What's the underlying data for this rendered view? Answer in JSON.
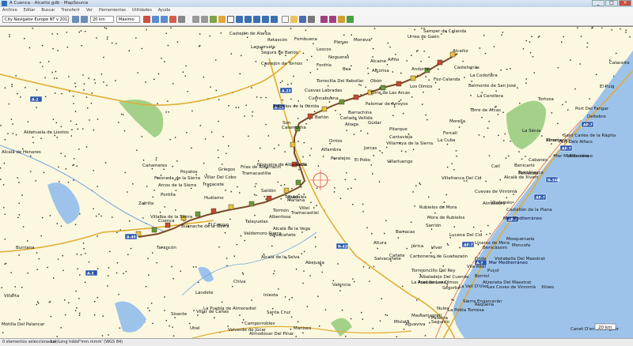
{
  "window": {
    "title": "A Cuenca - Alcañiz.gdb - MapSource"
  },
  "menu": [
    "Archivo",
    "Editar",
    "Buscar",
    "Transferir",
    "Ver",
    "Herramientas",
    "Utilidades",
    "Ayuda"
  ],
  "toolbar": {
    "map_product": "City Navigator Europe NT v 2013.1",
    "zoom": "20 km",
    "detail": "Máximo"
  },
  "status": {
    "selected": "0 elementos seleccionados",
    "coords": "Lat/Long hddd°mm.mmm' (WGS 84)"
  },
  "scale": "20 km",
  "cities": [
    {
      "name": "Castejón de Alarba"
    },
    {
      "name": "Retascón"
    },
    {
      "name": "Fombuena"
    },
    {
      "name": "Plenas"
    },
    {
      "name": "Moneva"
    },
    {
      "name": "Samper de Calanda"
    },
    {
      "name": "Urrea de Gaén"
    },
    {
      "name": "Alcañiz"
    },
    {
      "name": "Lagueruela"
    },
    {
      "name": "Loscos"
    },
    {
      "name": "Nogueras"
    },
    {
      "name": "Segura de Baños"
    },
    {
      "name": "Alcaine"
    },
    {
      "name": "Ariño"
    },
    {
      "name": "Andorra"
    },
    {
      "name": "Calaceite"
    },
    {
      "name": "Castelserás"
    },
    {
      "name": "Castejón de Tornos"
    },
    {
      "name": "Fonfría"
    },
    {
      "name": "Bea"
    },
    {
      "name": "Alcorisa"
    },
    {
      "name": "Foz-Calanda"
    },
    {
      "name": "La Codoñera"
    },
    {
      "name": "Torrecilla Del Rebollar"
    },
    {
      "name": "Obón"
    },
    {
      "name": "Los Olmos"
    },
    {
      "name": "Belmonte de San José"
    },
    {
      "name": "Cuevas Labradas"
    },
    {
      "name": "Torre de Las Arcas"
    },
    {
      "name": "La Cerollera"
    },
    {
      "name": "Rubielos de la Cérida"
    },
    {
      "name": "Cuencabuena"
    },
    {
      "name": "Palomar de Arroyos"
    },
    {
      "name": "Torre de Arcas"
    },
    {
      "name": "Tortosa"
    },
    {
      "name": "Port Del Fangar"
    },
    {
      "name": "Deltebre"
    },
    {
      "name": "Calamocha"
    },
    {
      "name": "Aliaga"
    },
    {
      "name": "Cañada Vellida"
    },
    {
      "name": "Barrachina"
    },
    {
      "name": "Son"
    },
    {
      "name": "Bañón"
    },
    {
      "name": "Gúdar"
    },
    {
      "name": "Pitarque"
    },
    {
      "name": "Morella"
    },
    {
      "name": "La Sénia"
    },
    {
      "name": "Sant Carles de la Rápita"
    },
    {
      "name": "Port Dels Alfacs"
    },
    {
      "name": "Aldehuela de Liestos"
    },
    {
      "name": "Alcalá de Henares"
    },
    {
      "name": "Orrios"
    },
    {
      "name": "Cantavieja"
    },
    {
      "name": "Forcall"
    },
    {
      "name": "La Cuba"
    },
    {
      "name": "Alfambra"
    },
    {
      "name": "Jorcas"
    },
    {
      "name": "Villarroya de la Sierra"
    },
    {
      "name": "Vinaròs"
    },
    {
      "name": "Peralejos"
    },
    {
      "name": "El Pobo"
    },
    {
      "name": "Mar Mediterráneo"
    },
    {
      "name": "Benicarló"
    },
    {
      "name": "Ulldecona"
    },
    {
      "name": "Nogueira de Albarracín"
    },
    {
      "name": "Cella"
    },
    {
      "name": "Teruel"
    },
    {
      "name": "Villarluengo"
    },
    {
      "name": "Catí"
    },
    {
      "name": "Peñíscola"
    },
    {
      "name": "Cañamares"
    },
    {
      "name": "Poyatos"
    },
    {
      "name": "Griegos"
    },
    {
      "name": "Frías de Albarracín"
    },
    {
      "name": "Fresneda de la Sierra"
    },
    {
      "name": "Villar Del Cobo"
    },
    {
      "name": "Tramacastilla"
    },
    {
      "name": "Villafranca Del Cid"
    },
    {
      "name": "Alcalà de Xivert"
    },
    {
      "name": "Torreblanca"
    },
    {
      "name": "Cabanes"
    },
    {
      "name": "Arcos de la Sierra"
    },
    {
      "name": "Tragacete"
    },
    {
      "name": "Saldón"
    },
    {
      "name": "Rubiales"
    },
    {
      "name": "Villel"
    },
    {
      "name": "Cuevas de Vinromà"
    },
    {
      "name": "Vilafamés"
    },
    {
      "name": "Castellón de la Plana"
    },
    {
      "name": "Portilla"
    },
    {
      "name": "Huélamo"
    },
    {
      "name": "Zafrilla"
    },
    {
      "name": "Tormón"
    },
    {
      "name": "El Cuervo"
    },
    {
      "name": "Albentosa"
    },
    {
      "name": "Tramacastiel"
    },
    {
      "name": "Cuenca"
    },
    {
      "name": "Buenache de la Sierra"
    },
    {
      "name": "Valdemoro-Sierra"
    },
    {
      "name": "Salvacañete"
    },
    {
      "name": "Alcalá de la Vega"
    },
    {
      "name": "Talayuelas"
    },
    {
      "name": "Lucena Del Cid"
    },
    {
      "name": "Onda"
    },
    {
      "name": "Vila-Real"
    },
    {
      "name": "Benicàssim"
    },
    {
      "name": "Burriana"
    },
    {
      "name": "Tarancón"
    },
    {
      "name": "Villalba de la Sierra"
    },
    {
      "name": "Mariana"
    },
    {
      "name": "Alcalá de la Selva"
    },
    {
      "name": "Abejuela"
    },
    {
      "name": "Aras de Los Olmos"
    },
    {
      "name": "Segorbe"
    },
    {
      "name": "La Vall D'Uixó"
    },
    {
      "name": "Nules"
    },
    {
      "name": "Sagunto"
    },
    {
      "name": "Puçol"
    },
    {
      "name": "Almenara"
    },
    {
      "name": "Aguaviva"
    },
    {
      "name": "Mislata"
    },
    {
      "name": "Massamagrell"
    },
    {
      "name": "Paterna"
    },
    {
      "name": "Manises"
    },
    {
      "name": "Utiel"
    },
    {
      "name": "Motilla Del Palancar"
    },
    {
      "name": "La Pueblanueva"
    },
    {
      "name": "Valencia"
    },
    {
      "name": "Requena"
    },
    {
      "name": "Chiva"
    },
    {
      "name": "Landete"
    },
    {
      "name": "Villarta"
    },
    {
      "name": "La Puebla de Almoradiel"
    },
    {
      "name": "Santa Cruz"
    },
    {
      "name": "Iniesta"
    },
    {
      "name": "Camporrobles"
    },
    {
      "name": "Valverde de Júcar"
    },
    {
      "name": "Almodóvar Del Pinar"
    },
    {
      "name": "Sisante"
    },
    {
      "name": "Villar de Cañas"
    },
    {
      "name": "Torrejoncillo Del Rey"
    },
    {
      "name": "Albaladejo Del Cuende"
    },
    {
      "name": "Carboneras de Guadazaón"
    },
    {
      "name": "Cañete"
    },
    {
      "name": "Salvacañete"
    },
    {
      "name": "Altura"
    },
    {
      "name": "Jérica"
    },
    {
      "name": "Viver"
    },
    {
      "name": "Barracas"
    },
    {
      "name": "Sarrión"
    },
    {
      "name": "Mora de Rubielos"
    },
    {
      "name": "Rubielos de Mora"
    },
    {
      "name": "Linares de Mora"
    },
    {
      "name": "Mosqueruela"
    },
    {
      "name": "Vistabella Del Maestrat"
    },
    {
      "name": "Atzeneta Del Maestrat"
    },
    {
      "name": "Les Coves de Vinromà"
    },
    {
      "name": "Sierra Engarcerán"
    },
    {
      "name": "La Pobla Tornesa"
    },
    {
      "name": "Borriol"
    },
    {
      "name": "Almassora"
    },
    {
      "name": "Moncofa"
    },
    {
      "name": "Xilxes"
    },
    {
      "name": "Canet D'en Berenguer"
    },
    {
      "name": "El Puig"
    }
  ],
  "roads": [
    "A-2",
    "A-23",
    "A-23",
    "A-40",
    "N-420",
    "A-3",
    "AP-7",
    "AP-7",
    "AP-7",
    "AP-7",
    "AP-7",
    "A-7",
    "N-340"
  ],
  "sea_labels": [
    "Mar Mediterráneo",
    "Mar Mediterráneo"
  ],
  "colors": {
    "map_bg": "#fbf8df",
    "route": "#7a4b2a",
    "highway": "#f0c24a",
    "water": "#9dc3ea",
    "park": "#a3d18a"
  }
}
